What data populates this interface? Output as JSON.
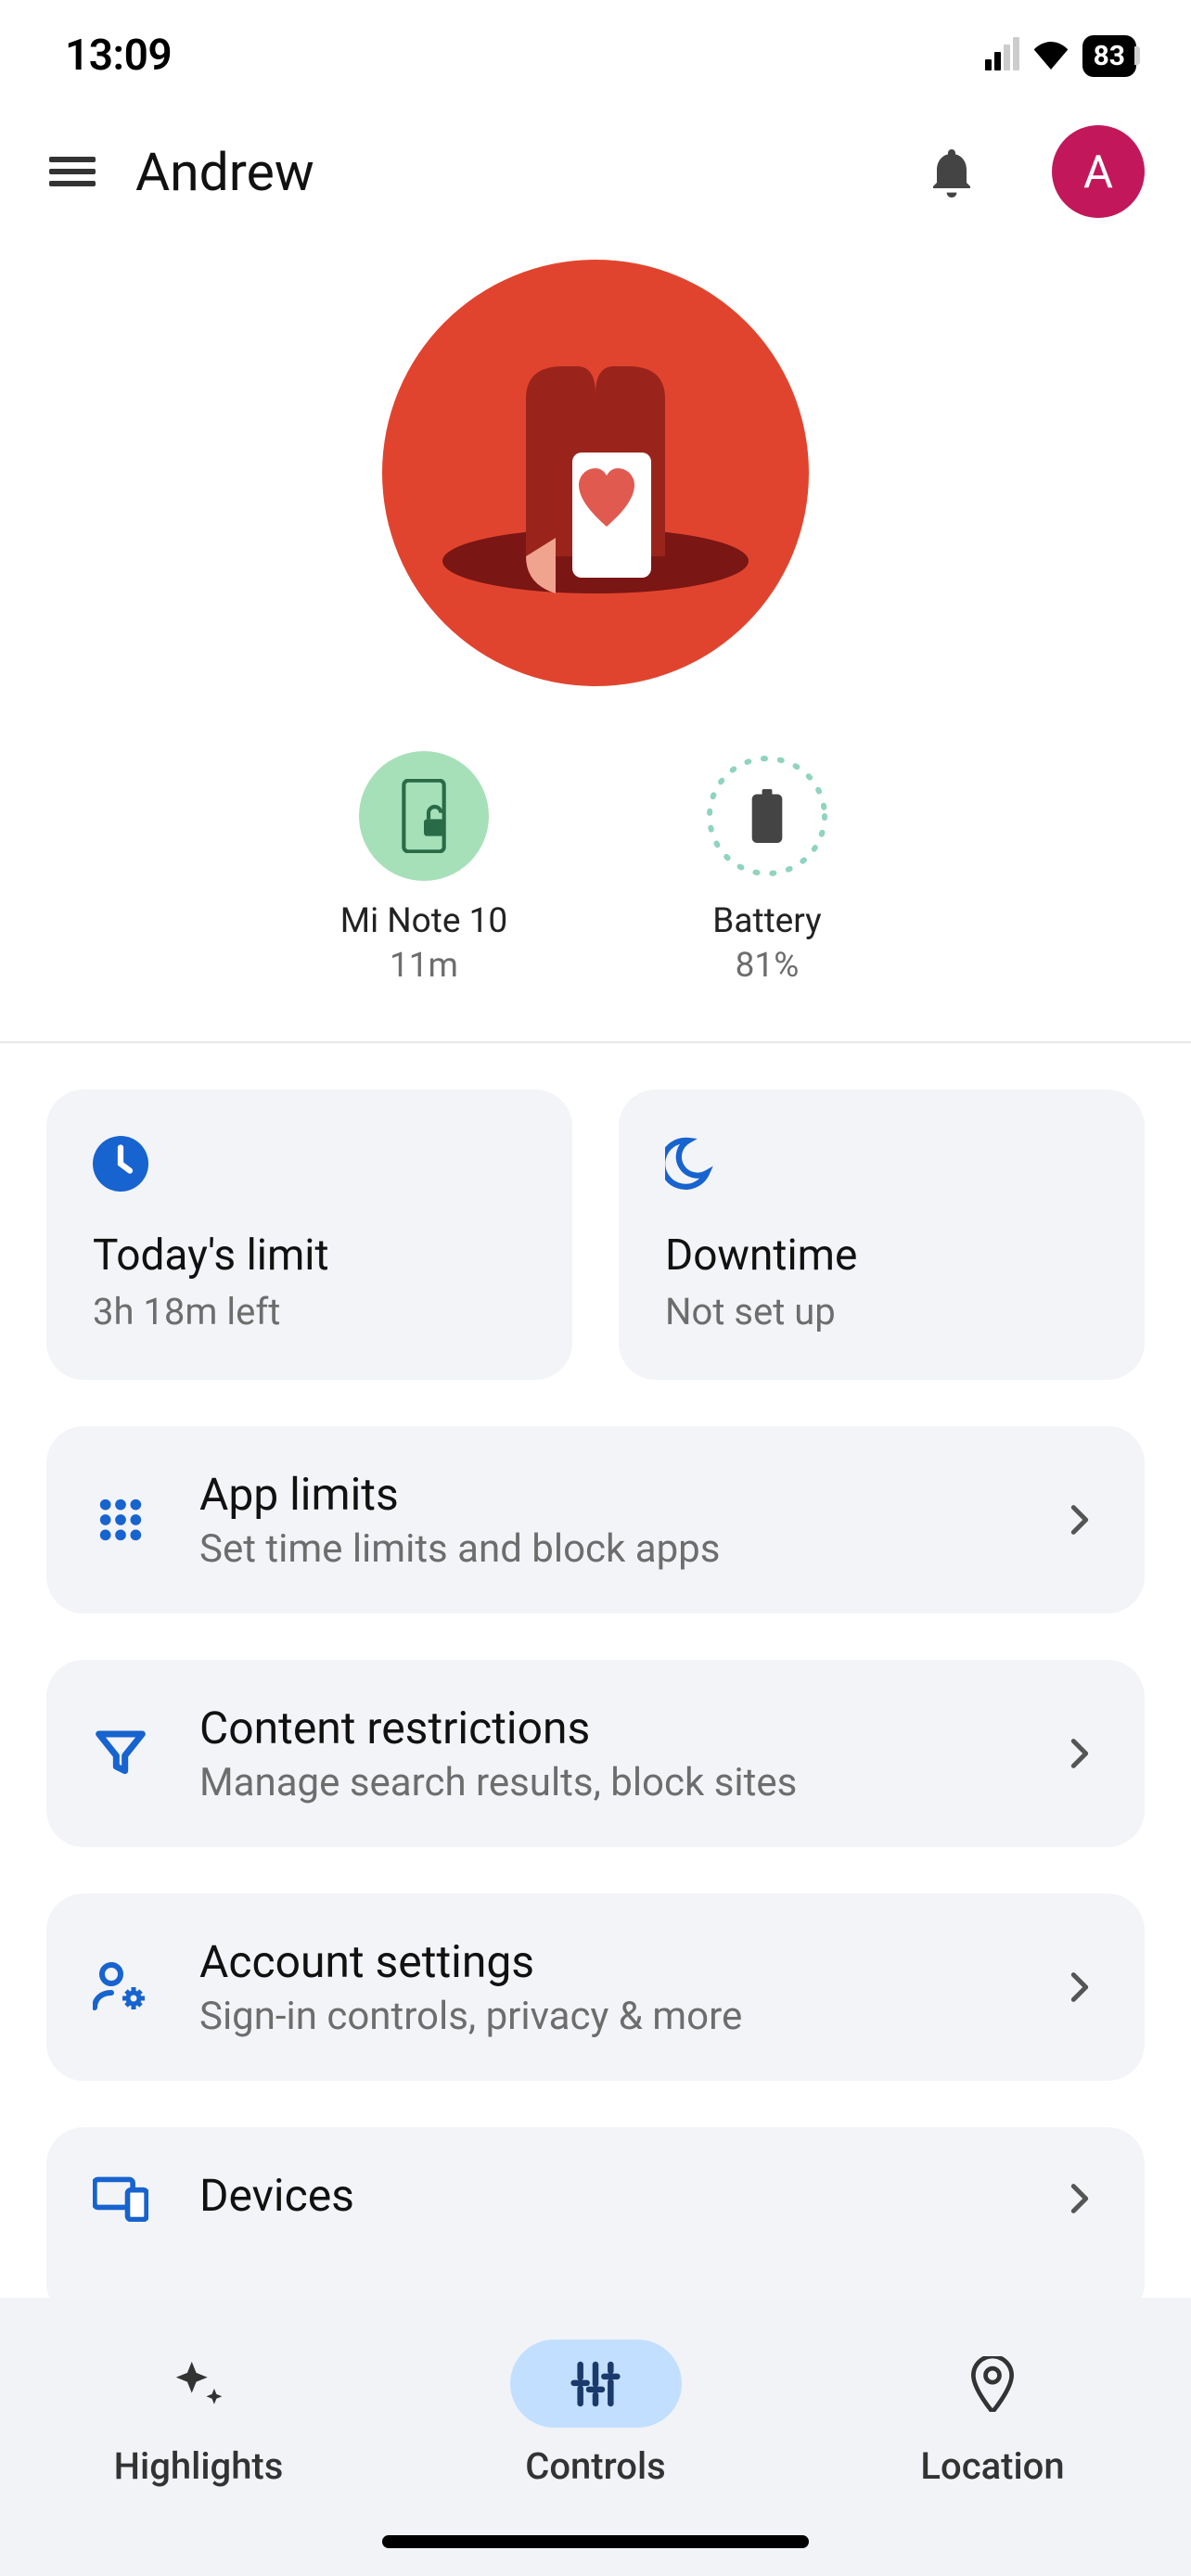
{
  "status": {
    "time": "13:09",
    "battery": "83"
  },
  "header": {
    "title": "Andrew",
    "avatar_initial": "A"
  },
  "device": {
    "name": "Mi Note 10",
    "last_seen": "11m"
  },
  "battery_status": {
    "label": "Battery",
    "percent": "81%"
  },
  "tiles": {
    "today_limit": {
      "title": "Today's limit",
      "sub": "3h 18m left"
    },
    "downtime": {
      "title": "Downtime",
      "sub": "Not set up"
    }
  },
  "rows": {
    "app_limits": {
      "title": "App limits",
      "sub": "Set time limits and block apps"
    },
    "content": {
      "title": "Content restrictions",
      "sub": "Manage search results, block sites"
    },
    "account": {
      "title": "Account settings",
      "sub": "Sign-in controls, privacy & more"
    },
    "devices": {
      "title": "Devices",
      "sub": ""
    }
  },
  "nav": {
    "highlights": "Highlights",
    "controls": "Controls",
    "location": "Location"
  }
}
